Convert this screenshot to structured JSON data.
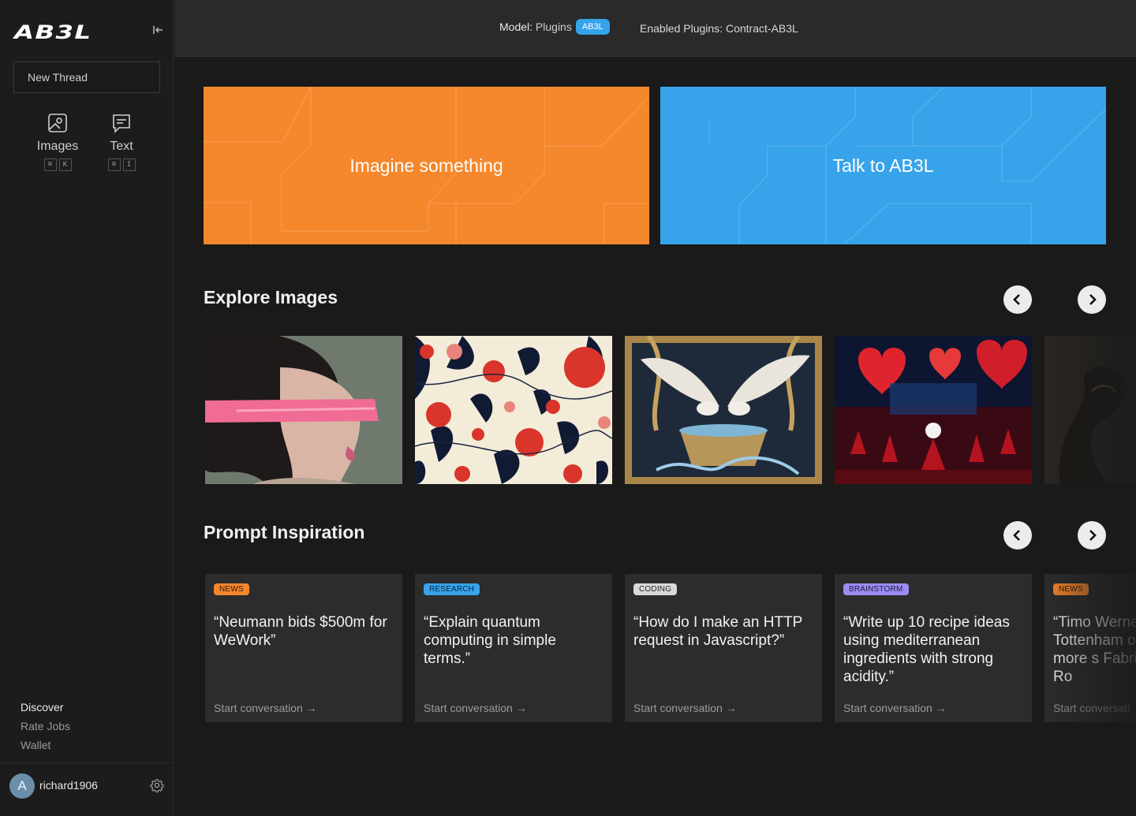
{
  "app": {
    "logo_text": "AB3L",
    "new_thread_label": "New Thread"
  },
  "modes": [
    {
      "label": "Images",
      "icon": "image-icon",
      "shortcut": [
        "⌘",
        "K"
      ]
    },
    {
      "label": "Text",
      "icon": "message-icon",
      "shortcut": [
        "⌘",
        "I"
      ]
    }
  ],
  "discover_nav": [
    {
      "label": "Discover",
      "active": true
    },
    {
      "label": "Rate Jobs",
      "active": false
    },
    {
      "label": "Wallet",
      "active": false
    }
  ],
  "user": {
    "initial": "A",
    "name": "richard1906"
  },
  "topbar": {
    "model_prefix": "Model:",
    "model_name": "Plugins",
    "model_badge": "AB3L",
    "plugins_text": "Enabled Plugins: Contract-AB3L"
  },
  "hero": [
    {
      "label": "Imagine something",
      "color": "#f5872c"
    },
    {
      "label": "Talk to AB3L",
      "color": "#37a3ea"
    }
  ],
  "explore_images": {
    "title": "Explore Images",
    "items": [
      "woman-with-pink-blindfold",
      "red-floral-pattern",
      "white-doves-fountain",
      "red-hearts-stage-show",
      "dark-dragon"
    ]
  },
  "prompt_inspiration": {
    "title": "Prompt Inspiration",
    "cards": [
      {
        "tag": "NEWS",
        "tag_type": "news",
        "text": "“Neumann bids $500m for WeWork”",
        "cta": "Start conversation →"
      },
      {
        "tag": "RESEARCH",
        "tag_type": "research",
        "text": "“Explain quantum computing in simple terms.”",
        "cta": "Start conversation →"
      },
      {
        "tag": "CODING",
        "tag_type": "coding",
        "text": "“How do I make an HTTP request in Javascript?”",
        "cta": "Start conversation →"
      },
      {
        "tag": "BRAINSTORM",
        "tag_type": "brainstorm",
        "text": "“Write up 10 recipe ideas using mediterranean ingredients with strong acidity.”",
        "cta": "Start conversation →"
      },
      {
        "tag": "NEWS",
        "tag_type": "news",
        "text": "“Timo Werner at Tottenham one more s Fabrizio Ro",
        "cta": "Start conversati"
      }
    ]
  }
}
